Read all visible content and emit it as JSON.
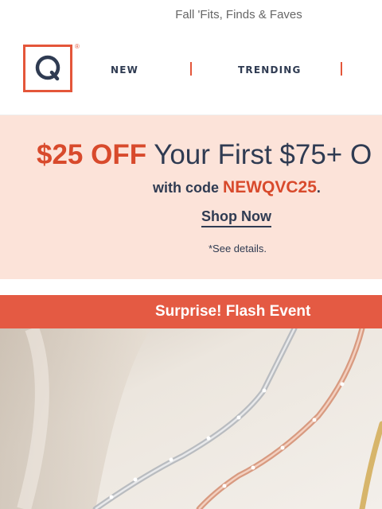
{
  "preheader": {
    "text": "Fall 'Fits, Finds & Faves"
  },
  "nav": {
    "logo_letter": "Q",
    "logo_mark": "®",
    "items": [
      {
        "label": "NEW"
      },
      {
        "label": "TRENDING"
      }
    ]
  },
  "promo": {
    "amount_off": "$25 OFF",
    "headline_rest": "Your First $75+ O",
    "code_prefix": "with code",
    "code": "NEWQVC25",
    "code_suffix": ".",
    "cta": "Shop Now",
    "details": "*See details."
  },
  "flash_banner": {
    "text": "Surprise! Flash Event"
  },
  "hero": {
    "subject": "jewelry-bracelets-photo"
  },
  "colors": {
    "brand": "#e4563a",
    "promo_bg": "#fce3d9",
    "navy": "#2f3b52"
  }
}
